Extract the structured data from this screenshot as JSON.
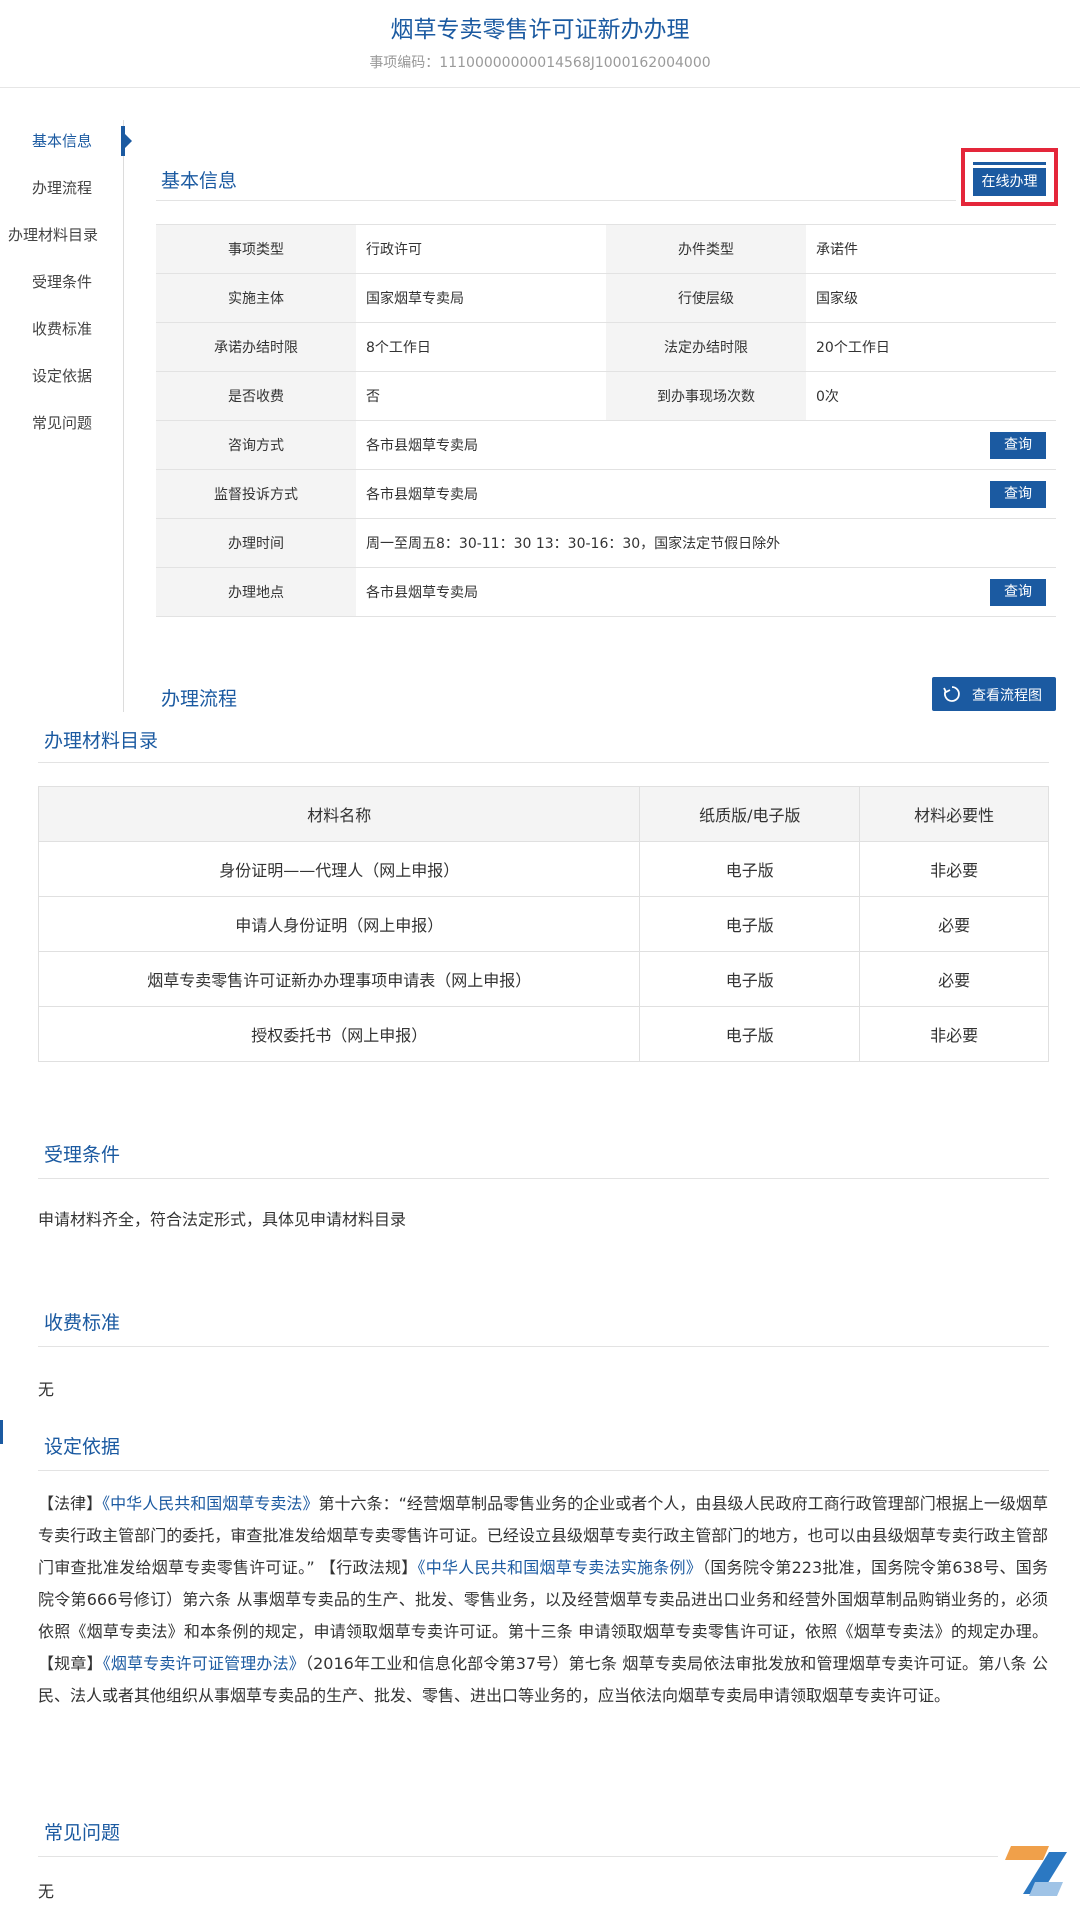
{
  "header": {
    "title": "烟草专卖零售许可证新办办理",
    "code": "事项编码：11100000000014568J1000162004000"
  },
  "sidenav": {
    "items": [
      "基本信息",
      "办理流程",
      "办理材料目录",
      "受理条件",
      "收费标准",
      "设定依据",
      "常见问题"
    ],
    "active": "基本信息"
  },
  "basic": {
    "title": "基本信息",
    "online_button": "在线办理",
    "rows": [
      {
        "l1": "事项类型",
        "v1": "行政许可",
        "l2": "办件类型",
        "v2": "承诺件"
      },
      {
        "l1": "实施主体",
        "v1": "国家烟草专卖局",
        "l2": "行使层级",
        "v2": "国家级"
      },
      {
        "l1": "承诺办结时限",
        "v1": "8个工作日",
        "l2": "法定办结时限",
        "v2": "20个工作日"
      },
      {
        "l1": "是否收费",
        "v1": "否",
        "l2": "到办事现场次数",
        "v2": "0次"
      }
    ],
    "wide_rows": [
      {
        "label": "咨询方式",
        "value": "各市县烟草专卖局",
        "button": "查询"
      },
      {
        "label": "监督投诉方式",
        "value": "各市县烟草专卖局",
        "button": "查询"
      },
      {
        "label": "办理时间",
        "value": "周一至周五8：30-11：30 13：30-16：30，国家法定节假日除外",
        "button": ""
      },
      {
        "label": "办理地点",
        "value": "各市县烟草专卖局",
        "button": "查询"
      }
    ]
  },
  "process": {
    "title": "办理流程",
    "button": "查看流程图"
  },
  "materials": {
    "title": "办理材料目录",
    "headers": [
      "材料名称",
      "纸质版/电子版",
      "材料必要性"
    ],
    "rows": [
      [
        "身份证明——代理人（网上申报）",
        "电子版",
        "非必要"
      ],
      [
        "申请人身份证明（网上申报）",
        "电子版",
        "必要"
      ],
      [
        "烟草专卖零售许可证新办办理事项申请表（网上申报）",
        "电子版",
        "必要"
      ],
      [
        "授权委托书（网上申报）",
        "电子版",
        "非必要"
      ]
    ]
  },
  "conditions": {
    "title": "受理条件",
    "text": "申请材料齐全，符合法定形式，具体见申请材料目录"
  },
  "fees": {
    "title": "收费标准",
    "text": "无"
  },
  "basis": {
    "title": "设定依据",
    "s1": "【法律】",
    "l1": "《中华人民共和国烟草专卖法》",
    "s2": "第十六条：“经营烟草制品零售业务的企业或者个人，由县级人民政府工商行政管理部门根据上一级烟草专卖行政主管部门的委托，审查批准发给烟草专卖零售许可证。已经设立县级烟草专卖行政主管部门的地方，也可以由县级烟草专卖行政主管部门审查批准发给烟草专卖零售许可证。” 【行政法规】",
    "l2": "《中华人民共和国烟草专卖法实施条例》",
    "s3": "（国务院令第223批准，国务院令第638号、国务院令第666号修订）第六条 从事烟草专卖品的生产、批发、零售业务，以及经营烟草专卖品进出口业务和经营外国烟草制品购销业务的，必须依照《烟草专卖法》和本条例的规定，申请领取烟草专卖许可证。第十三条 申请领取烟草专卖零售许可证，依照《烟草专卖法》的规定办理。【规章】",
    "l3": "《烟草专卖许可证管理办法》",
    "s4": "（2016年工业和信息化部令第37号）第七条 烟草专卖局依法审批发放和管理烟草专卖许可证。第八条 公民、法人或者其他组织从事烟草专卖品的生产、批发、零售、进出口等业务的，应当依法向烟草专卖局申请领取烟草专卖许可证。"
  },
  "faq": {
    "title": "常见问题",
    "text": "无"
  },
  "colors": {
    "accent": "#1b5aa1",
    "highlight": "#e4263a"
  }
}
